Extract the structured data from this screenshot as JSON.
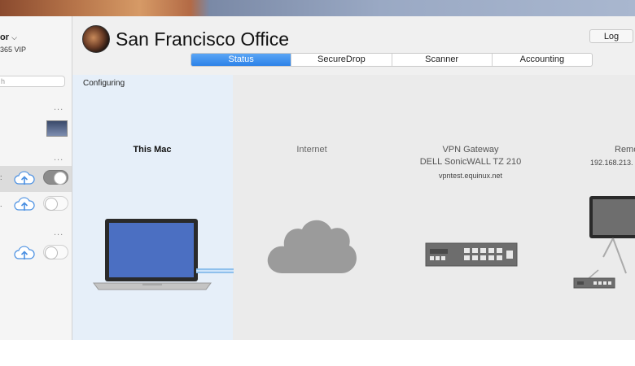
{
  "sidebar": {
    "account_name": "or",
    "account_chevron": "⌵",
    "account_plan": "365 VIP",
    "search_placeholder": "h",
    "more_label": "...",
    "connections": [
      {
        "state": "on",
        "icon": "cloud-upload-icon"
      },
      {
        "state": "off",
        "icon": "cloud-upload-icon"
      },
      {
        "state": "off",
        "icon": "cloud-upload-icon"
      }
    ]
  },
  "header": {
    "title": "San Francisco Office",
    "log_label": "Log",
    "tabs": [
      {
        "label": "Status",
        "active": true
      },
      {
        "label": "SecureDrop",
        "active": false
      },
      {
        "label": "Scanner",
        "active": false
      },
      {
        "label": "Accounting",
        "active": false
      }
    ]
  },
  "status": {
    "state_text": "Configuring",
    "nodes": {
      "this_mac": {
        "label": "This Mac",
        "icon": "laptop-icon"
      },
      "internet": {
        "label": "Internet",
        "icon": "cloud-icon"
      },
      "vpn_gateway": {
        "label": "VPN Gateway",
        "model": "DELL SonicWALL TZ 210",
        "host": "vpntest.equinux.net",
        "icon": "router-icon"
      },
      "remote_network": {
        "label": "Remote Net",
        "address": "192.168.213.",
        "icon": "network-computer-icon"
      }
    }
  },
  "colors": {
    "accent": "#2c82e8",
    "mac_column_bg": "#e6eff9",
    "connection_line": "#8fc0ec"
  }
}
